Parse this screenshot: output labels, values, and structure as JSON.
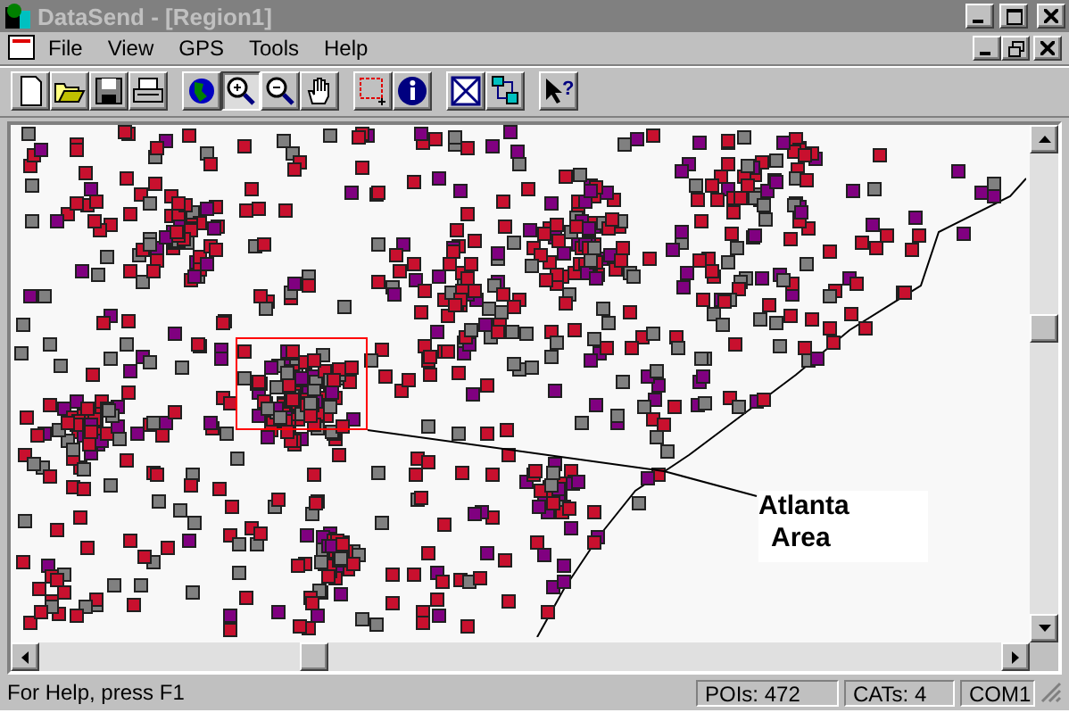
{
  "window": {
    "title": "DataSend - [Region1]"
  },
  "menu": [
    "File",
    "View",
    "GPS",
    "Tools",
    "Help"
  ],
  "toolbar": [
    {
      "kind": "new",
      "pressed": false
    },
    {
      "kind": "open",
      "pressed": false
    },
    {
      "kind": "save",
      "pressed": false
    },
    {
      "kind": "print",
      "pressed": false
    },
    {
      "kind": "sep"
    },
    {
      "kind": "globe",
      "pressed": false
    },
    {
      "kind": "zoomin",
      "pressed": true
    },
    {
      "kind": "zoomout",
      "pressed": false
    },
    {
      "kind": "hand",
      "pressed": false
    },
    {
      "kind": "sep"
    },
    {
      "kind": "select",
      "pressed": false
    },
    {
      "kind": "info",
      "pressed": false
    },
    {
      "kind": "sep"
    },
    {
      "kind": "clear",
      "pressed": false
    },
    {
      "kind": "network",
      "pressed": false
    },
    {
      "kind": "sep"
    },
    {
      "kind": "helpcursor",
      "pressed": false,
      "glyph": "?"
    }
  ],
  "map": {
    "label_lines": [
      "Atlanta",
      "Area"
    ]
  },
  "status_bar": {
    "message": "For Help, press F1",
    "pois": "POIs: 472",
    "cats": "CATs: 4",
    "port": "COM1"
  }
}
